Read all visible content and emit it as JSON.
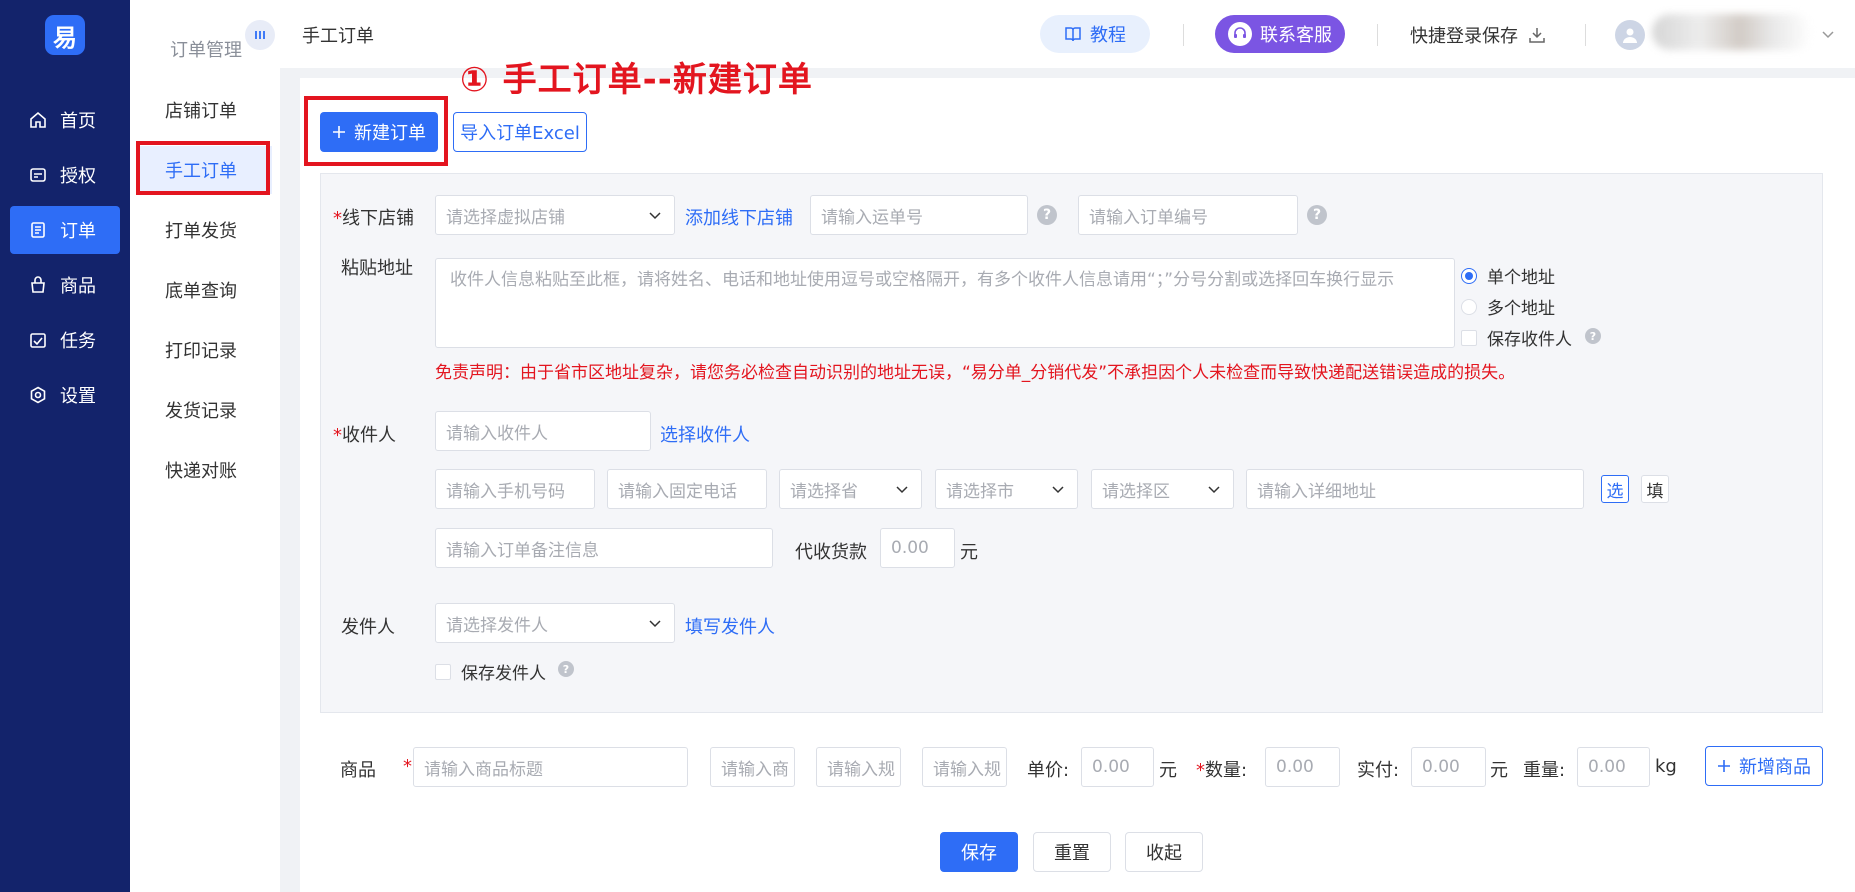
{
  "logo": {
    "text": "易"
  },
  "nav": {
    "items": [
      {
        "label": "首页",
        "icon": "home-icon"
      },
      {
        "label": "授权",
        "icon": "authorize-icon"
      },
      {
        "label": "订单",
        "icon": "order-icon"
      },
      {
        "label": "商品",
        "icon": "goods-icon"
      },
      {
        "label": "任务",
        "icon": "task-icon"
      },
      {
        "label": "设置",
        "icon": "settings-icon"
      }
    ]
  },
  "subnav": {
    "title": "订单管理",
    "items": [
      "店铺订单",
      "手工订单",
      "打单发货",
      "底单查询",
      "打印记录",
      "发货记录",
      "快递对账"
    ]
  },
  "header": {
    "title": "手工订单",
    "tutorial": "教程",
    "service": "联系客服",
    "quick_save": "快捷登录保存"
  },
  "annotation": "① 手工订单--新建订单",
  "actions": {
    "new_order": "新建订单",
    "import_excel": "导入订单Excel"
  },
  "form": {
    "store_label": "线下店铺",
    "store_placeholder": "请选择虚拟店铺",
    "add_store": "添加线下店铺",
    "waybill_placeholder": "请输入运单号",
    "order_no_placeholder": "请输入订单编号",
    "paste_label": "粘贴地址",
    "paste_placeholder": "收件人信息粘贴至此框，请将姓名、电话和地址使用逗号或空格隔开，有多个收件人信息请用“；”分号分割或选择回车换行显示",
    "single_address": "单个地址",
    "multi_address": "多个地址",
    "save_receiver": "保存收件人",
    "disclaimer": "免责声明：由于省市区地址复杂，请您务必检查自动识别的地址无误，“易分单_分销代发”不承担因个人未检查而导致快递配送错误造成的损失。",
    "receiver_label": "收件人",
    "receiver_placeholder": "请输入收件人",
    "choose_receiver": "选择收件人",
    "phone_placeholder": "请输入手机号码",
    "tel_placeholder": "请输入固定电话",
    "province_placeholder": "请选择省",
    "city_placeholder": "请选择市",
    "district_placeholder": "请选择区",
    "detail_placeholder": "请输入详细地址",
    "select_btn": "选",
    "fill_btn": "填",
    "remark_placeholder": "请输入订单备注信息",
    "cod_label": "代收货款",
    "cod_value": "0.00",
    "yuan": "元",
    "sender_label": "发件人",
    "sender_placeholder": "请选择发件人",
    "fill_sender": "填写发件人",
    "save_sender": "保存发件人"
  },
  "goods": {
    "label": "商品",
    "title_placeholder": "请输入商品标题",
    "sku1_placeholder": "请输入商",
    "sku2_placeholder": "请输入规",
    "sku3_placeholder": "请输入规",
    "price_label": "单价:",
    "price_value": "0.00",
    "qty_label": "数量:",
    "qty_value": "0.00",
    "paid_label": "实付:",
    "paid_value": "0.00",
    "weight_label": "重量:",
    "weight_value": "0.00",
    "weight_unit": "kg",
    "yuan": "元",
    "add_goods": "新增商品"
  },
  "footer": {
    "save": "保存",
    "reset": "重置",
    "collapse": "收起"
  },
  "colors": {
    "nav_bg": "#13236b",
    "primary": "#2e6df6",
    "service": "#7b55e3",
    "annotation_red": "#e3151f"
  }
}
